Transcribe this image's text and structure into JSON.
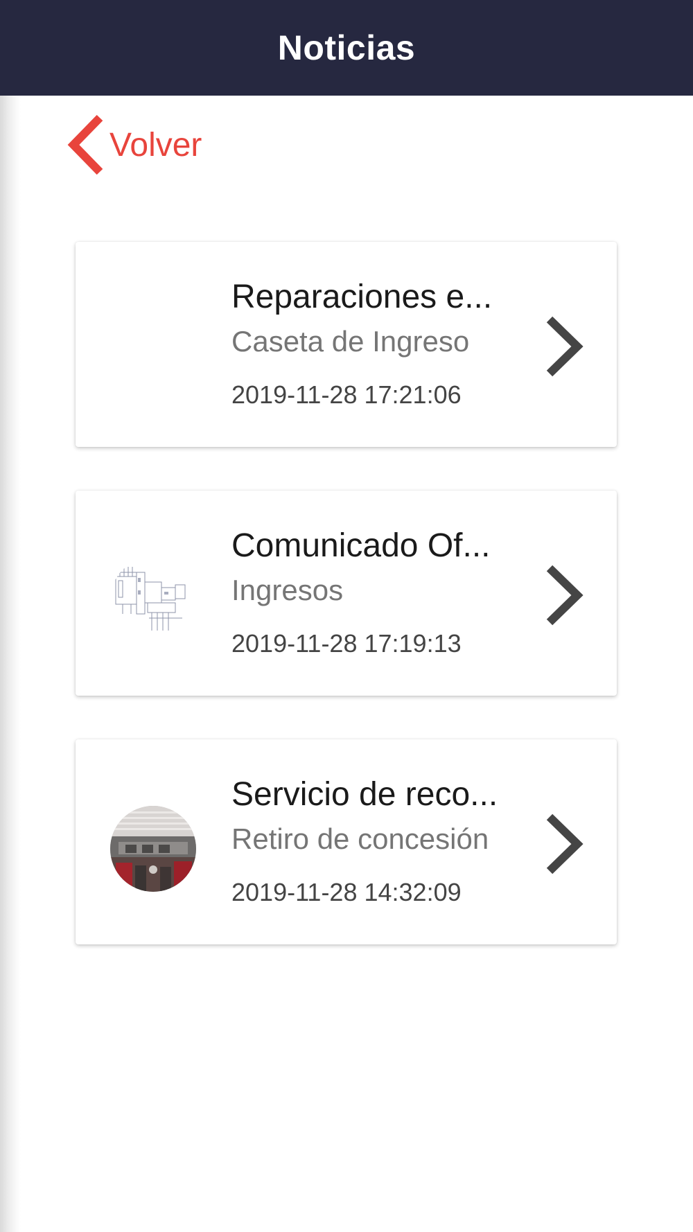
{
  "header": {
    "title": "Noticias"
  },
  "back": {
    "label": "Volver"
  },
  "colors": {
    "header_bg": "#262840",
    "accent": "#e8443c",
    "chevron": "#454545"
  },
  "news": [
    {
      "title": "Reparaciones e...",
      "category": "Caseta de Ingreso",
      "date": "2019-11-28 17:21:06",
      "thumbnail": "none"
    },
    {
      "title": "Comunicado Of...",
      "category": "Ingresos",
      "date": "2019-11-28 17:19:13",
      "thumbnail": "floor-plan-sketch"
    },
    {
      "title": "Servicio de reco...",
      "category": "Retiro de concesión",
      "date": "2019-11-28 14:32:09",
      "thumbnail": "street-photo"
    }
  ]
}
